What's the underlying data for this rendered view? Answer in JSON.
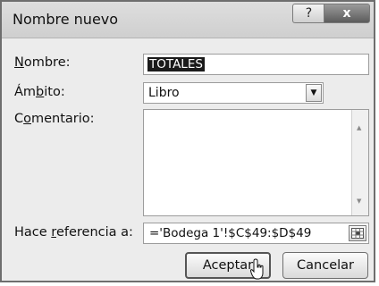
{
  "window": {
    "title": "Nombre nuevo",
    "help_label": "?",
    "close_label": "x"
  },
  "form": {
    "name_label": "Nombre:",
    "name_value": "TOTALES",
    "scope_label": "Ámbito:",
    "scope_value": "Libro",
    "comment_label": "Comentario:",
    "comment_value": "",
    "reference_label": "Hace referencia a:",
    "reference_value": "='Bodega 1'!$C$49:$D$49"
  },
  "buttons": {
    "ok_label": "Aceptar",
    "cancel_label": "Cancelar"
  },
  "icons": [
    "help-icon",
    "close-icon",
    "dropdown-arrow-icon",
    "scroll-up-arrow-icon",
    "scroll-down-arrow-icon",
    "range-select-icon",
    "mouse-cursor-icon"
  ]
}
